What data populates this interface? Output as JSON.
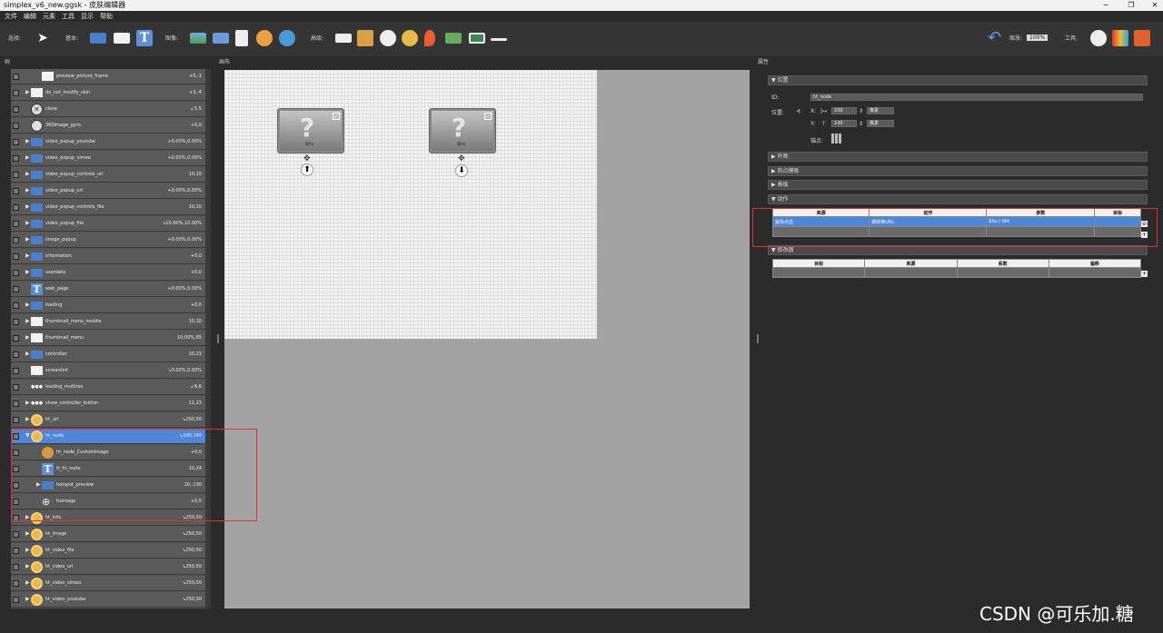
{
  "window": {
    "title": "simplex_v6_new.ggsk - 皮肤编辑器"
  },
  "menu": [
    "文件",
    "编辑",
    "元素",
    "工具",
    "显示",
    "帮助"
  ],
  "toolbar": {
    "select_label": "选择:",
    "basic_label": "基本:",
    "image_label": "图像:",
    "advanced_label": "高级:",
    "zoom_label": "缩放:",
    "zoom_value": "100%",
    "tools_label": "工具:"
  },
  "panels": {
    "tree": "树",
    "canvas": "画布",
    "props": "属性"
  },
  "tree_rows": [
    {
      "name": "preview_picture_frame",
      "value": "+0,-1",
      "icon": "white",
      "arrow": "",
      "indent": 2
    },
    {
      "name": "do_not_modify_skin",
      "value": "+3,-4",
      "icon": "white",
      "arrow": "▶",
      "indent": 1
    },
    {
      "name": "close",
      "value": "↙5,5",
      "icon": "circle",
      "arrow": "",
      "indent": 1
    },
    {
      "name": "360image_gyro",
      "value": "+0,0",
      "icon": "circle",
      "arrow": "",
      "indent": 1
    },
    {
      "name": "video_popup_youtube",
      "value": "+0.00%,0.00%",
      "icon": "folder",
      "arrow": "▶",
      "indent": 1
    },
    {
      "name": "video_popup_vimeo",
      "value": "+0.00%,0.00%",
      "icon": "folder",
      "arrow": "▶",
      "indent": 1
    },
    {
      "name": "video_popup_controls_url",
      "value": "10,10",
      "icon": "folder",
      "arrow": "▶",
      "indent": 1
    },
    {
      "name": "video_popup_url",
      "value": "+0.00%,0.00%",
      "icon": "folder",
      "arrow": "▶",
      "indent": 1
    },
    {
      "name": "video_popup_controls_file",
      "value": "10,10",
      "icon": "folder",
      "arrow": "▶",
      "indent": 1
    },
    {
      "name": "video_popup_file",
      "value": "↘10.00%,10.00%",
      "icon": "folder",
      "arrow": "▶",
      "indent": 1
    },
    {
      "name": "image_popup",
      "value": "+0.00%,0.00%",
      "icon": "folder",
      "arrow": "▶",
      "indent": 1
    },
    {
      "name": "information",
      "value": "+0,0",
      "icon": "folder",
      "arrow": "▶",
      "indent": 1
    },
    {
      "name": "userdata",
      "value": "+0,0",
      "icon": "folder",
      "arrow": "▶",
      "indent": 1
    },
    {
      "name": "web_page",
      "value": "+0.00%,0.00%",
      "icon": "text",
      "arrow": "",
      "indent": 1
    },
    {
      "name": "loading",
      "value": "+0,0",
      "icon": "folder",
      "arrow": "▶",
      "indent": 1
    },
    {
      "name": "thumbnail_menu_mobile",
      "value": "10,10",
      "icon": "white",
      "arrow": "▶",
      "indent": 1
    },
    {
      "name": "thumbnail_menu",
      "value": "10,00%,65",
      "icon": "white",
      "arrow": "▶",
      "indent": 1
    },
    {
      "name": "controller",
      "value": "10,23",
      "icon": "folder",
      "arrow": "▶",
      "indent": 1
    },
    {
      "name": "screentint",
      "value": "↘0.00%,0.00%",
      "icon": "white",
      "arrow": "",
      "indent": 1
    },
    {
      "name": "loading_multires",
      "value": "↙6,6",
      "icon": "dots",
      "arrow": "",
      "indent": 1
    },
    {
      "name": "show_controller_button",
      "value": "11,23",
      "icon": "dots",
      "arrow": "▶",
      "indent": 1
    },
    {
      "name": "ht_url",
      "value": "↘250,50",
      "icon": "hot",
      "arrow": "▶",
      "indent": 1
    },
    {
      "name": "ht_node",
      "value": "↘100,140",
      "icon": "hot",
      "arrow": "▼",
      "indent": 1,
      "selected": true
    },
    {
      "name": "ht_node_CustomImage",
      "value": "+0,0",
      "icon": "globe",
      "arrow": "",
      "indent": 2
    },
    {
      "name": "tt_ht_node",
      "value": "10,24",
      "icon": "text",
      "arrow": "",
      "indent": 2
    },
    {
      "name": "hotspot_preview",
      "value": "10,-130",
      "icon": "folder",
      "arrow": "▶",
      "indent": 2
    },
    {
      "name": "hsimage",
      "value": "+0,0",
      "icon": "target",
      "arrow": "",
      "indent": 2
    },
    {
      "name": "ht_info",
      "value": "↘250,50",
      "icon": "hot",
      "arrow": "▶",
      "indent": 1
    },
    {
      "name": "ht_image",
      "value": "↘250,50",
      "icon": "hot",
      "arrow": "▶",
      "indent": 1
    },
    {
      "name": "ht_video_file",
      "value": "↘250,50",
      "icon": "hot",
      "arrow": "▶",
      "indent": 1
    },
    {
      "name": "ht_video_url",
      "value": "↘250,50",
      "icon": "hot",
      "arrow": "▶",
      "indent": 1
    },
    {
      "name": "ht_video_vimeo",
      "value": "↘250,50",
      "icon": "hot",
      "arrow": "▶",
      "indent": 1
    },
    {
      "name": "ht_video_youtube",
      "value": "↘250,50",
      "icon": "hot",
      "arrow": "▶",
      "indent": 1
    }
  ],
  "canvas": {
    "hotspot_label": "$hs",
    "arrow_up": "⬆",
    "arrow_down": "⬇",
    "move_glyph": "✥"
  },
  "props": {
    "position_section": "位置",
    "id_label": "ID:",
    "id_value": "ht_node",
    "pos_label": "位置:",
    "x_label": "X:",
    "x_value": "100",
    "y_label": "Y:",
    "y_value": "140",
    "unit": "像素",
    "anchor_label": "锚点:",
    "sections": [
      "外观",
      "热点模板",
      "高级",
      "动作"
    ],
    "actions_header": [
      "来源",
      "动作",
      "参数",
      "目标"
    ],
    "actions_row": [
      "鼠标点击",
      "跳转到URL",
      "$hu / $ht",
      ""
    ],
    "modifier_section": "修改器",
    "modifier_header": [
      "目标",
      "来源",
      "系数",
      "偏移"
    ],
    "plus": "+"
  },
  "watermark": "CSDN @可乐加.糖"
}
